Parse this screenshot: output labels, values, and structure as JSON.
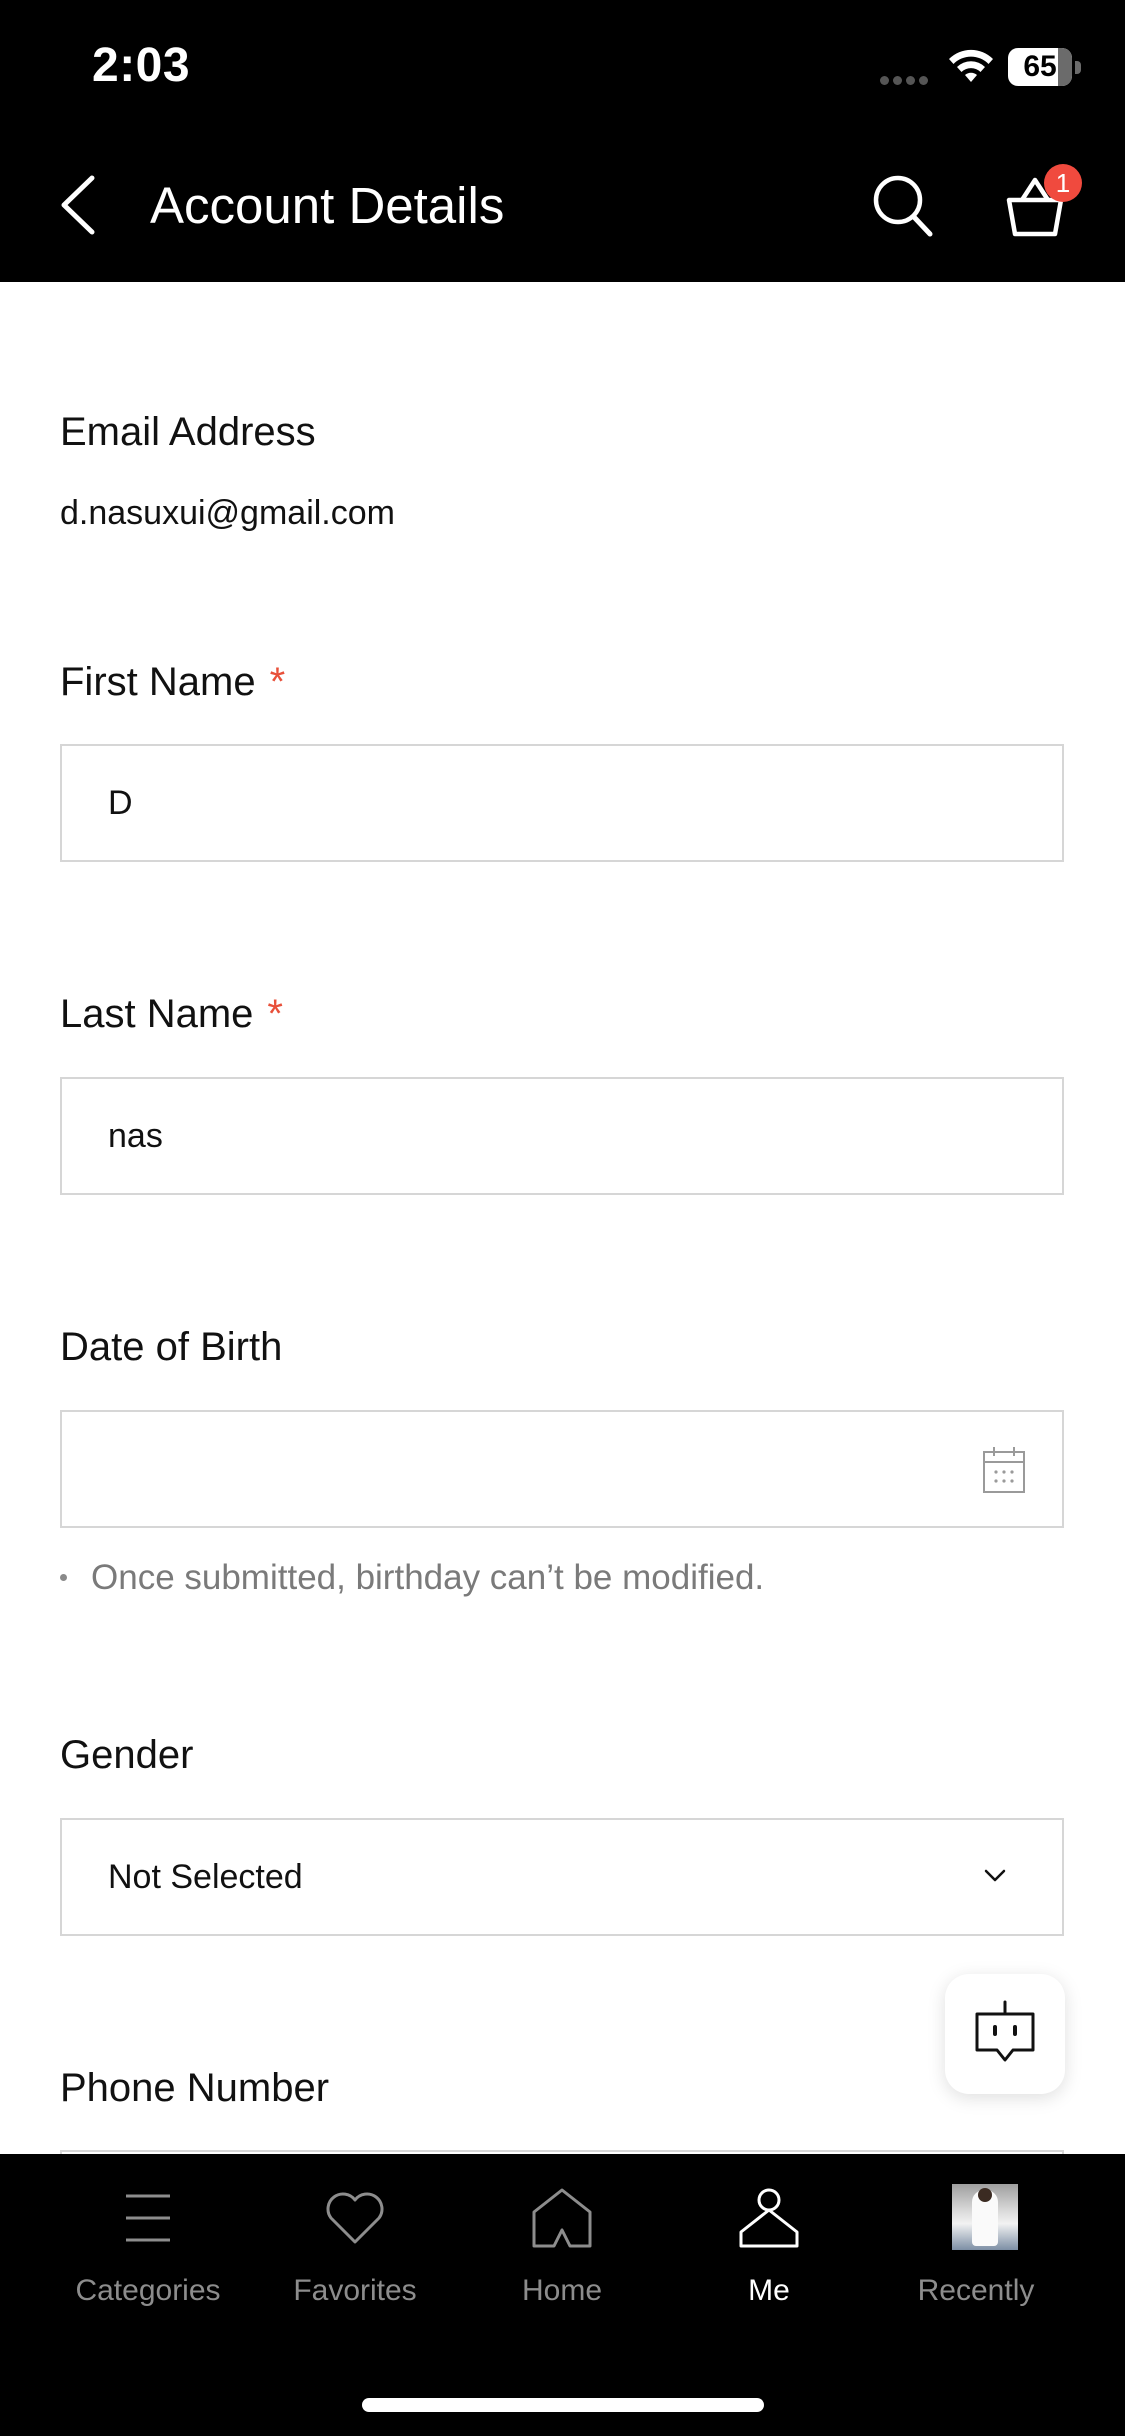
{
  "status_bar": {
    "time": "2:03",
    "battery": "65"
  },
  "header": {
    "title": "Account Details",
    "cart_count": "1"
  },
  "form": {
    "email": {
      "label": "Email Address",
      "value": "d.nasuxui@gmail.com"
    },
    "first_name": {
      "label": "First Name",
      "required_mark": "*",
      "value": "D"
    },
    "last_name": {
      "label": "Last Name",
      "required_mark": "*",
      "value": "nas"
    },
    "dob": {
      "label": "Date of Birth",
      "value": "",
      "hint": "Once submitted, birthday can’t be modified."
    },
    "gender": {
      "label": "Gender",
      "value": "Not Selected"
    },
    "phone": {
      "label": "Phone Number"
    }
  },
  "tabs": [
    {
      "label": "Categories",
      "icon": "categories-icon"
    },
    {
      "label": "Favorites",
      "icon": "heart-icon"
    },
    {
      "label": "Home",
      "icon": "home-icon"
    },
    {
      "label": "Me",
      "icon": "hanger-icon",
      "active": true
    },
    {
      "label": "Recently",
      "icon": "recent-thumbnail"
    }
  ],
  "colors": {
    "header_bg": "#000000",
    "required": "#e8503a",
    "badge": "#f04a3e",
    "tab_inactive": "#8d8d8d",
    "tab_active": "#ffffff"
  }
}
